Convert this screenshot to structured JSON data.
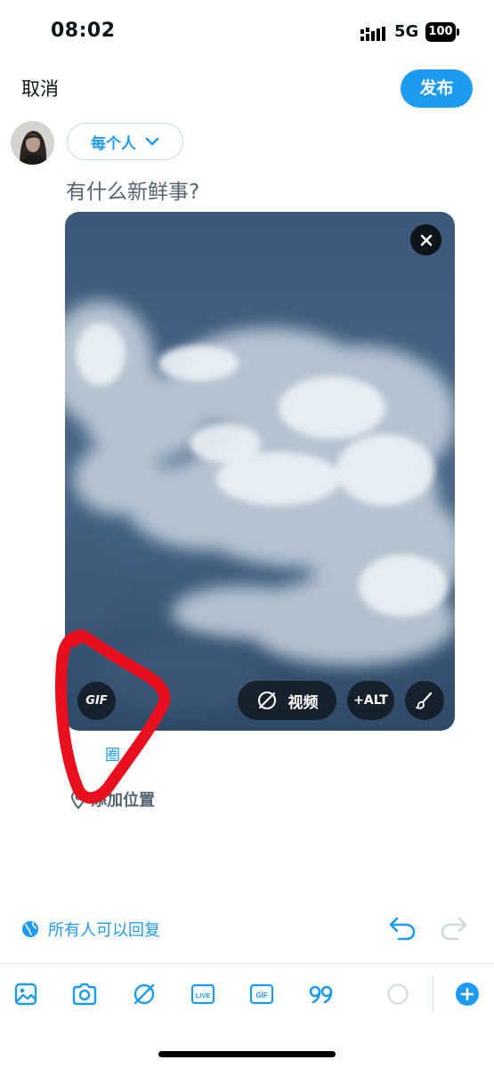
{
  "status_bar": {
    "time": "08:02",
    "network": "5G",
    "battery": "100"
  },
  "header": {
    "cancel_label": "取消",
    "publish_label": "发布"
  },
  "composer": {
    "audience": "每个人",
    "placeholder": "有什么新鲜事?",
    "media": {
      "gif_label": "GIF",
      "video_label": "视频",
      "alt_label": "+ALT"
    },
    "tag_people_label": "圈",
    "location_label": "添加位置"
  },
  "reply_setting": {
    "label": "所有人可以回复"
  },
  "toolbar": {
    "icons": [
      "image-icon",
      "camera-icon",
      "video-off-icon",
      "live-icon",
      "gif-icon",
      "quote-icon",
      "progress-circle-icon",
      "add-icon"
    ],
    "live_label": "LIVE",
    "gif_label": "GIF"
  },
  "colors": {
    "accent": "#1d9bf0",
    "annotation": "#e8101e"
  }
}
